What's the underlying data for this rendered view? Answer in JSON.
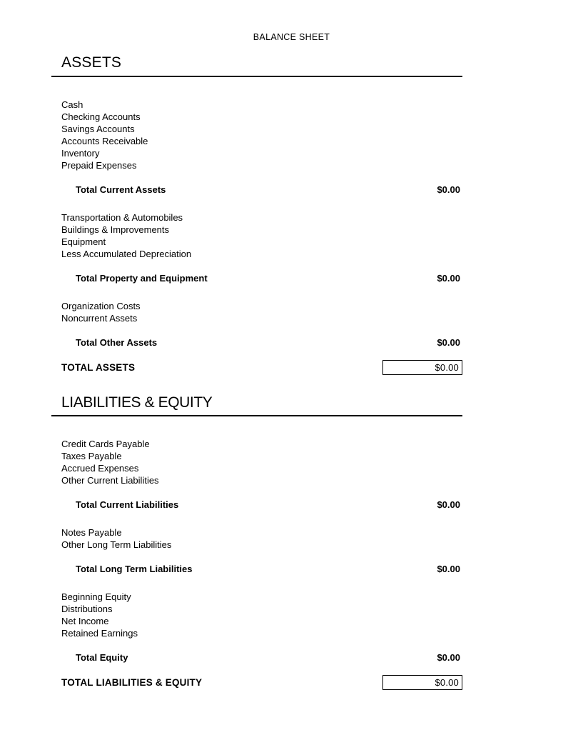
{
  "document": {
    "title": "BALANCE SHEET"
  },
  "sections": [
    {
      "heading": "ASSETS",
      "groups": [
        {
          "items": [
            {
              "label": "Cash"
            },
            {
              "label": "Checking Accounts"
            },
            {
              "label": "Savings Accounts"
            },
            {
              "label": "Accounts Receivable"
            },
            {
              "label": "Inventory"
            },
            {
              "label": "Prepaid Expenses"
            }
          ],
          "subtotal": {
            "label": "Total Current Assets",
            "value": "$0.00"
          }
        },
        {
          "items": [
            {
              "label": "Transportation & Automobiles"
            },
            {
              "label": "Buildings & Improvements"
            },
            {
              "label": "Equipment"
            },
            {
              "label": "Less Accumulated Depreciation"
            }
          ],
          "subtotal": {
            "label": "Total Property and Equipment",
            "value": "$0.00"
          }
        },
        {
          "items": [
            {
              "label": "Organization Costs"
            },
            {
              "label": "Noncurrent Assets"
            }
          ],
          "subtotal": {
            "label": "Total Other Assets",
            "value": "$0.00"
          }
        }
      ],
      "grand_total": {
        "label": "TOTAL ASSETS",
        "value": "$0.00"
      }
    },
    {
      "heading": "LIABILITIES & EQUITY",
      "groups": [
        {
          "items": [
            {
              "label": "Credit Cards Payable"
            },
            {
              "label": "Taxes Payable"
            },
            {
              "label": "Accrued Expenses"
            },
            {
              "label": "Other Current Liabilities"
            }
          ],
          "subtotal": {
            "label": "Total Current Liabilities",
            "value": "$0.00"
          }
        },
        {
          "items": [
            {
              "label": "Notes Payable"
            },
            {
              "label": "Other Long Term Liabilities"
            }
          ],
          "subtotal": {
            "label": "Total Long Term Liabilities",
            "value": "$0.00"
          }
        },
        {
          "items": [
            {
              "label": "Beginning Equity"
            },
            {
              "label": "Distributions"
            },
            {
              "label": "Net Income"
            },
            {
              "label": "Retained Earnings"
            }
          ],
          "subtotal": {
            "label": "Total Equity",
            "value": "$0.00"
          }
        }
      ],
      "grand_total": {
        "label": "TOTAL LIABILITIES & EQUITY",
        "value": "$0.00"
      }
    }
  ],
  "colors": {
    "text": "#000000",
    "rule": "#000000",
    "background": "#ffffff"
  }
}
